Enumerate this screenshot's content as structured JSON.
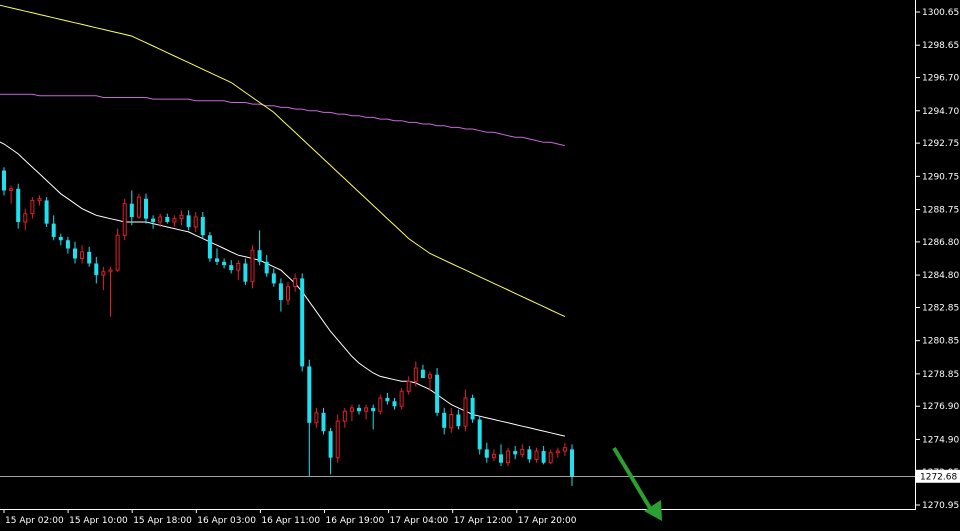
{
  "chart_data": {
    "type": "candlestick",
    "x_ticks": [
      "15 Apr 02:00",
      "15 Apr 10:00",
      "15 Apr 18:00",
      "16 Apr 03:00",
      "16 Apr 11:00",
      "16 Apr 19:00",
      "17 Apr 04:00",
      "17 Apr 12:00",
      "17 Apr 20:00"
    ],
    "y_ticks": [
      "1300.65",
      "1298.65",
      "1296.70",
      "1294.70",
      "1292.75",
      "1290.75",
      "1288.75",
      "1286.80",
      "1284.80",
      "1282.85",
      "1280.85",
      "1278.85",
      "1276.90",
      "1274.90",
      "1272.95",
      "1270.95"
    ],
    "ylim": [
      1270.95,
      1300.65
    ],
    "current_price": 1272.68,
    "current_price_label": "1272.68",
    "colors": {
      "up": "#e0202a",
      "down": "#1ee0f0",
      "ma_fast": "#ffffff",
      "ma_mid": "#ffff55",
      "ma_slow": "#cc66dd",
      "arrow": "#2aa030",
      "price_line": "#ffffff"
    },
    "candles": [
      [
        1291.1,
        1291.3,
        1289.6,
        1289.9
      ],
      [
        1289.9,
        1290.2,
        1289.1,
        1290.0
      ],
      [
        1290.0,
        1290.3,
        1287.6,
        1288.0
      ],
      [
        1288.0,
        1288.8,
        1287.5,
        1288.5
      ],
      [
        1288.5,
        1289.5,
        1288.2,
        1289.3
      ],
      [
        1289.3,
        1289.6,
        1289.0,
        1289.4
      ],
      [
        1289.3,
        1289.5,
        1287.7,
        1287.9
      ],
      [
        1287.9,
        1288.4,
        1286.9,
        1287.1
      ],
      [
        1287.1,
        1287.3,
        1286.6,
        1286.9
      ],
      [
        1286.9,
        1287.1,
        1286.1,
        1286.4
      ],
      [
        1286.4,
        1286.8,
        1285.5,
        1285.8
      ],
      [
        1285.8,
        1286.6,
        1285.5,
        1286.2
      ],
      [
        1286.2,
        1286.5,
        1285.3,
        1285.5
      ],
      [
        1285.5,
        1285.9,
        1284.3,
        1284.8
      ],
      [
        1284.8,
        1285.3,
        1283.9,
        1285.0
      ],
      [
        1285.0,
        1285.3,
        1282.3,
        1285.1
      ],
      [
        1285.1,
        1287.6,
        1285.0,
        1287.2
      ],
      [
        1287.2,
        1289.4,
        1286.9,
        1289.1
      ],
      [
        1289.1,
        1289.9,
        1287.8,
        1288.3
      ],
      [
        1288.3,
        1289.7,
        1288.2,
        1289.5
      ],
      [
        1289.4,
        1289.7,
        1287.9,
        1288.2
      ],
      [
        1288.2,
        1288.4,
        1287.6,
        1288.0
      ],
      [
        1288.0,
        1288.5,
        1287.7,
        1288.3
      ],
      [
        1288.3,
        1288.5,
        1287.9,
        1288.0
      ],
      [
        1288.0,
        1288.4,
        1287.7,
        1288.2
      ],
      [
        1288.2,
        1288.7,
        1287.8,
        1288.4
      ],
      [
        1288.4,
        1288.7,
        1287.5,
        1287.7
      ],
      [
        1287.7,
        1288.6,
        1287.4,
        1288.3
      ],
      [
        1288.3,
        1288.6,
        1287.0,
        1287.2
      ],
      [
        1287.2,
        1287.4,
        1285.6,
        1285.8
      ],
      [
        1285.8,
        1286.4,
        1285.4,
        1285.6
      ],
      [
        1285.6,
        1285.8,
        1285.2,
        1285.4
      ],
      [
        1285.4,
        1285.7,
        1284.9,
        1285.1
      ],
      [
        1285.1,
        1285.7,
        1284.5,
        1285.5
      ],
      [
        1285.5,
        1285.8,
        1284.2,
        1284.4
      ],
      [
        1284.4,
        1286.6,
        1284.0,
        1286.3
      ],
      [
        1286.3,
        1287.5,
        1285.4,
        1285.6
      ],
      [
        1285.6,
        1286.0,
        1284.7,
        1284.9
      ],
      [
        1284.9,
        1285.2,
        1284.1,
        1284.3
      ],
      [
        1284.3,
        1284.6,
        1282.6,
        1283.3
      ],
      [
        1283.3,
        1284.4,
        1283.0,
        1284.1
      ],
      [
        1284.1,
        1284.9,
        1283.8,
        1284.6
      ],
      [
        1284.6,
        1284.9,
        1279.0,
        1279.3
      ],
      [
        1279.3,
        1279.7,
        1272.7,
        1275.9
      ],
      [
        1275.9,
        1276.8,
        1275.6,
        1276.5
      ],
      [
        1276.5,
        1276.8,
        1275.2,
        1275.4
      ],
      [
        1275.4,
        1275.6,
        1272.8,
        1273.8
      ],
      [
        1273.8,
        1276.4,
        1273.5,
        1276.0
      ],
      [
        1276.0,
        1276.8,
        1275.6,
        1276.6
      ],
      [
        1276.6,
        1277.0,
        1276.0,
        1276.8
      ],
      [
        1276.8,
        1277.0,
        1276.4,
        1276.6
      ],
      [
        1276.6,
        1277.0,
        1276.1,
        1276.8
      ],
      [
        1276.8,
        1277.0,
        1275.5,
        1276.6
      ],
      [
        1276.6,
        1277.6,
        1276.4,
        1277.4
      ],
      [
        1277.4,
        1277.7,
        1277.0,
        1277.2
      ],
      [
        1277.2,
        1277.4,
        1276.7,
        1276.9
      ],
      [
        1276.9,
        1278.0,
        1276.7,
        1277.8
      ],
      [
        1277.8,
        1278.7,
        1277.6,
        1278.4
      ],
      [
        1278.4,
        1279.6,
        1278.1,
        1279.2
      ],
      [
        1279.1,
        1279.4,
        1278.8,
        1278.6
      ],
      [
        1278.6,
        1279.0,
        1277.8,
        1278.8
      ],
      [
        1278.8,
        1279.2,
        1276.3,
        1276.5
      ],
      [
        1276.5,
        1276.8,
        1275.2,
        1275.6
      ],
      [
        1275.6,
        1276.8,
        1275.3,
        1276.4
      ],
      [
        1276.4,
        1276.7,
        1275.5,
        1275.7
      ],
      [
        1275.7,
        1277.9,
        1275.4,
        1277.4
      ],
      [
        1277.4,
        1277.6,
        1275.9,
        1276.1
      ],
      [
        1276.1,
        1276.3,
        1274.0,
        1274.3
      ],
      [
        1274.3,
        1274.7,
        1273.5,
        1273.8
      ],
      [
        1273.8,
        1274.3,
        1273.6,
        1274.0
      ],
      [
        1274.0,
        1274.6,
        1273.3,
        1273.5
      ],
      [
        1273.5,
        1274.4,
        1273.3,
        1274.2
      ],
      [
        1274.2,
        1274.5,
        1273.7,
        1274.0
      ],
      [
        1274.0,
        1274.6,
        1273.8,
        1274.3
      ],
      [
        1274.3,
        1274.5,
        1273.5,
        1273.7
      ],
      [
        1273.7,
        1274.4,
        1273.5,
        1274.2
      ],
      [
        1274.2,
        1274.5,
        1273.4,
        1273.5
      ],
      [
        1273.5,
        1274.3,
        1273.4,
        1274.1
      ],
      [
        1274.1,
        1274.4,
        1273.8,
        1274.2
      ],
      [
        1274.2,
        1274.7,
        1273.9,
        1274.4
      ],
      [
        1274.3,
        1274.6,
        1272.1,
        1272.7
      ]
    ],
    "ma_fast": [
      1292.9,
      1292.7,
      1292.4,
      1292.1,
      1291.7,
      1291.3,
      1290.9,
      1290.5,
      1290.1,
      1289.7,
      1289.4,
      1289.1,
      1288.8,
      1288.6,
      1288.4,
      1288.3,
      1288.2,
      1288.1,
      1288.0,
      1288.0,
      1288.0,
      1288.0,
      1287.9,
      1287.8,
      1287.7,
      1287.6,
      1287.5,
      1287.4,
      1287.2,
      1287.0,
      1286.8,
      1286.6,
      1286.4,
      1286.2,
      1286.0,
      1285.9,
      1285.8,
      1285.7,
      1285.5,
      1285.3,
      1285.1,
      1284.7,
      1284.3,
      1283.8,
      1283.2,
      1282.6,
      1282.0,
      1281.4,
      1280.9,
      1280.4,
      1279.9,
      1279.5,
      1279.2,
      1278.9,
      1278.7,
      1278.6,
      1278.5,
      1278.4,
      1278.4,
      1278.3,
      1278.1,
      1277.9,
      1277.6,
      1277.3,
      1277.0,
      1276.8,
      1276.6,
      1276.4,
      1276.3,
      1276.2,
      1276.1,
      1276.0,
      1275.9,
      1275.8,
      1275.7,
      1275.6,
      1275.5,
      1275.4,
      1275.3,
      1275.2,
      1275.1
    ],
    "ma_mid": [
      1301.1,
      1301.0,
      1300.9,
      1300.8,
      1300.7,
      1300.6,
      1300.5,
      1300.4,
      1300.3,
      1300.2,
      1300.1,
      1300.0,
      1299.9,
      1299.8,
      1299.7,
      1299.6,
      1299.5,
      1299.4,
      1299.3,
      1299.2,
      1299.0,
      1298.8,
      1298.6,
      1298.4,
      1298.2,
      1298.0,
      1297.8,
      1297.6,
      1297.4,
      1297.2,
      1297.0,
      1296.8,
      1296.6,
      1296.4,
      1296.1,
      1295.8,
      1295.5,
      1295.2,
      1294.9,
      1294.6,
      1294.2,
      1293.8,
      1293.4,
      1293.0,
      1292.6,
      1292.2,
      1291.8,
      1291.4,
      1291.0,
      1290.6,
      1290.2,
      1289.8,
      1289.4,
      1289.0,
      1288.6,
      1288.2,
      1287.8,
      1287.4,
      1287.0,
      1286.7,
      1286.4,
      1286.1,
      1285.9,
      1285.7,
      1285.5,
      1285.3,
      1285.1,
      1284.9,
      1284.7,
      1284.5,
      1284.3,
      1284.1,
      1283.9,
      1283.7,
      1283.5,
      1283.3,
      1283.1,
      1282.9,
      1282.7,
      1282.5,
      1282.3
    ],
    "ma_slow": [
      1295.7,
      1295.7,
      1295.7,
      1295.7,
      1295.7,
      1295.7,
      1295.6,
      1295.6,
      1295.6,
      1295.6,
      1295.6,
      1295.6,
      1295.6,
      1295.6,
      1295.6,
      1295.5,
      1295.5,
      1295.5,
      1295.5,
      1295.5,
      1295.5,
      1295.5,
      1295.4,
      1295.4,
      1295.4,
      1295.4,
      1295.4,
      1295.4,
      1295.3,
      1295.3,
      1295.3,
      1295.3,
      1295.3,
      1295.2,
      1295.2,
      1295.2,
      1295.1,
      1295.1,
      1295.0,
      1295.0,
      1294.9,
      1294.9,
      1294.8,
      1294.8,
      1294.7,
      1294.7,
      1294.6,
      1294.6,
      1294.5,
      1294.5,
      1294.4,
      1294.4,
      1294.3,
      1294.3,
      1294.2,
      1294.2,
      1294.1,
      1294.1,
      1294.0,
      1294.0,
      1293.9,
      1293.9,
      1293.8,
      1293.8,
      1293.7,
      1293.7,
      1293.6,
      1293.6,
      1293.5,
      1293.4,
      1293.4,
      1293.3,
      1293.2,
      1293.1,
      1293.1,
      1293.0,
      1292.9,
      1292.8,
      1292.8,
      1292.7,
      1292.6
    ]
  }
}
